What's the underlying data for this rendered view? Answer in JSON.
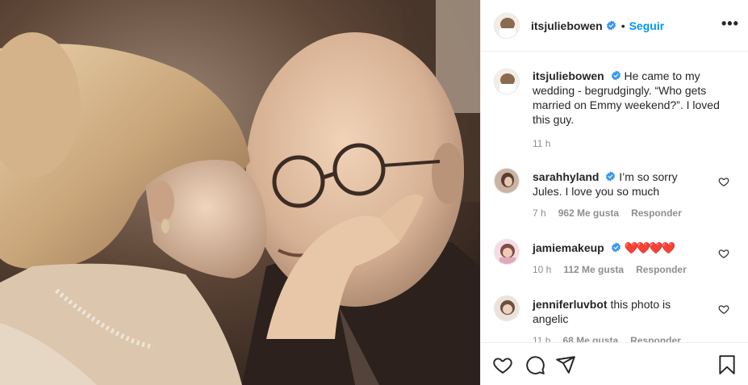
{
  "post": {
    "username": "itsjuliebowen",
    "follow_label": "Seguir",
    "dot": "•",
    "more_label": "•••"
  },
  "caption": {
    "username": "itsjuliebowen",
    "text": "He came to my wedding - begrudgingly. “Who gets married on Emmy weekend?”. I loved this guy.",
    "time": "11 h"
  },
  "comments": [
    {
      "username": "sarahhyland",
      "verified": true,
      "text": "I’m so sorry Jules. I love you so much",
      "time": "7 h",
      "likes": "962 Me gusta",
      "reply": "Responder"
    },
    {
      "username": "jamiemakeup",
      "verified": true,
      "text": "❤️❤️❤️❤️",
      "time": "10 h",
      "likes": "112 Me gusta",
      "reply": "Responder"
    },
    {
      "username": "jenniferluvbot",
      "verified": false,
      "text": "this photo is angelic",
      "time": "11 h",
      "likes": "68 Me gusta",
      "reply": "Responder"
    }
  ],
  "icons": [
    "verified-badge-icon",
    "more-options-icon",
    "heart-icon",
    "comment-icon",
    "share-icon",
    "bookmark-icon"
  ],
  "colors": {
    "accent": "#0095f6",
    "text": "#262626",
    "muted": "#8e8e8e",
    "heart": "#ed4956"
  }
}
